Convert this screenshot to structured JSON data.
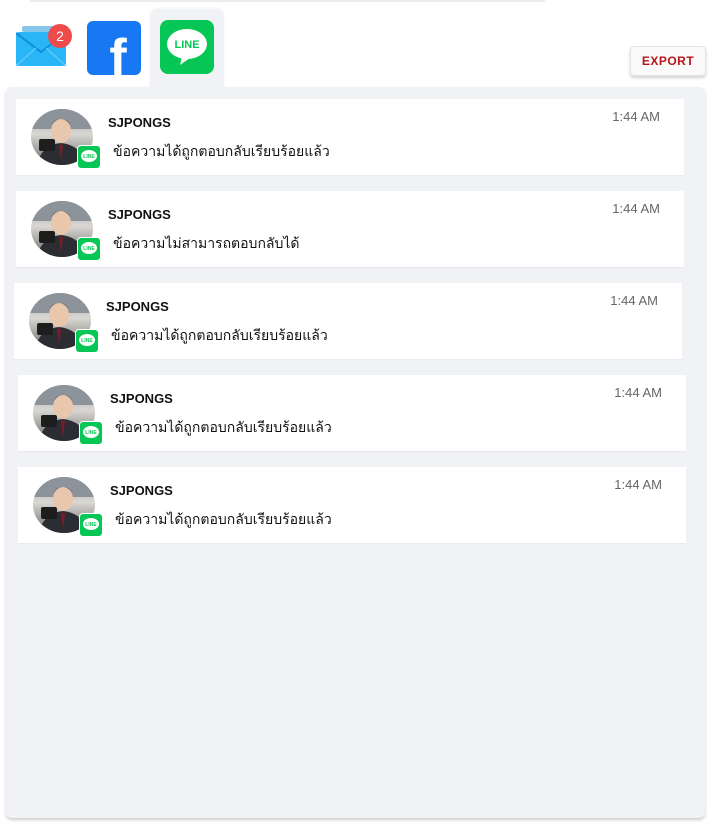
{
  "tabs": {
    "email": {
      "badge_count": "2"
    },
    "facebook": {
      "glyph": "f"
    },
    "line": {
      "logo_text": "LINE"
    }
  },
  "toolbar": {
    "export_label": "EXPORT"
  },
  "messages": [
    {
      "sender": "SJPONGS",
      "text": "ข้อความได้ถูกตอบกลับเรียบร้อยแล้ว",
      "time": "1:44 AM"
    },
    {
      "sender": "SJPONGS",
      "text": "ข้อความไม่สามารถตอบกลับได้",
      "time": "1:44 AM"
    },
    {
      "sender": "SJPONGS",
      "text": "ข้อความได้ถูกตอบกลับเรียบร้อยแล้ว",
      "time": "1:44 AM"
    },
    {
      "sender": "SJPONGS",
      "text": "ข้อความได้ถูกตอบกลับเรียบร้อยแล้ว",
      "time": "1:44 AM"
    },
    {
      "sender": "SJPONGS",
      "text": "ข้อความได้ถูกตอบกลับเรียบร้อยแล้ว",
      "time": "1:44 AM"
    }
  ],
  "colors": {
    "line_green": "#06c755",
    "facebook_blue": "#1877f2",
    "email_blue": "#29b6f6",
    "badge_red": "#ef4b4b",
    "export_red": "#b3171c",
    "panel_bg": "#f0f2f5"
  }
}
